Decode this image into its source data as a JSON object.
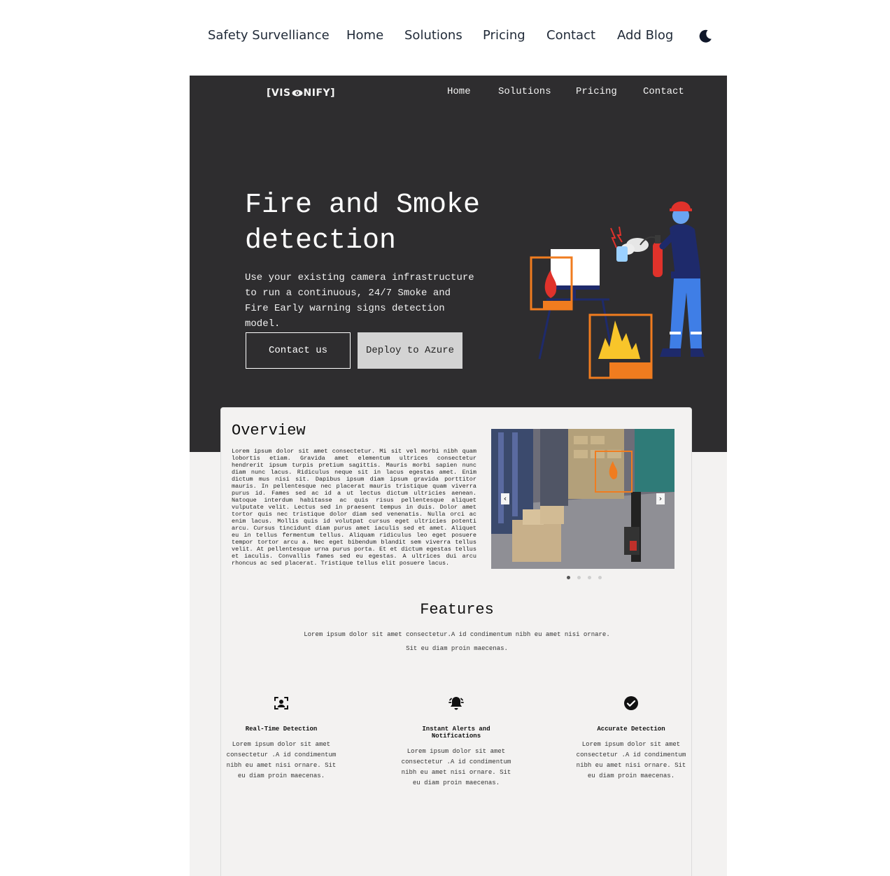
{
  "topnav": {
    "brand": "Safety Survelliance",
    "items": [
      "Home",
      "Solutions",
      "Pricing",
      "Contact",
      "Add Blog"
    ],
    "theme_toggle_icon": "moon-icon"
  },
  "preview": {
    "logo": {
      "left": "[VIS",
      "right": "NIFY]"
    },
    "nav": [
      "Home",
      "Solutions",
      "Pricing",
      "Contact"
    ],
    "hero": {
      "title": "Fire and Smoke detection",
      "description": "Use your existing camera infrastructure to run a continuous, 24/7 Smoke and Fire Early warning signs detection model.",
      "contact_label": "Contact us",
      "azure_label": "Deploy to Azure"
    },
    "overview": {
      "title": "Overview",
      "text": "Lorem ipsum dolor sit amet consectetur. Mi sit vel morbi nibh quam lobortis etiam. Gravida amet elementum ultrices consectetur hendrerit ipsum turpis pretium sagittis. Mauris morbi sapien nunc diam nunc lacus. Ridiculus neque sit in lacus egestas amet. Enim dictum mus nisi sit. Dapibus ipsum diam ipsum gravida porttitor mauris. In pellentesque nec placerat mauris tristique quam viverra purus id. Fames sed ac id a ut lectus dictum ultricies aenean. Natoque interdum habitasse ac quis risus pellentesque aliquet vulputate velit. Lectus sed in praesent tempus in duis. Dolor amet tortor quis nec tristique dolor diam sed venenatis. Nulla orci ac enim lacus. Mollis quis id volutpat cursus eget ultricies potenti arcu. Cursus tincidunt diam purus amet iaculis sed et amet. Aliquet eu in tellus fermentum tellus. Aliquam ridiculus leo eget posuere tempor tortor arcu a. Nec eget bibendum blandit sem viverra tellus velit. At pellentesque urna purus porta. Et et dictum egestas tellus et iaculis. Convallis fames sed eu egestas. A ultrices dui arcu rhoncus ac sed placerat. Tristique tellus elit posuere lacus.",
      "carousel": {
        "prev": "‹",
        "next": "›",
        "slides": 4,
        "active": 1
      }
    },
    "features": {
      "title": "Features",
      "subtitle_line1": "Lorem ipsum dolor sit amet consectetur.A id condimentum nibh eu amet nisi ornare.",
      "subtitle_line2": "Sit eu diam proin maecenas.",
      "items": [
        {
          "icon": "face-scan-icon",
          "name": "Real-Time Detection",
          "desc": "Lorem ipsum dolor sit amet consectetur .A id condimentum nibh eu amet nisi ornare. Sit eu diam proin maecenas."
        },
        {
          "icon": "alarm-bell-icon",
          "name": "Instant Alerts and Notifications",
          "desc": "Lorem ipsum dolor sit amet consectetur .A id condimentum nibh eu amet nisi ornare. Sit eu diam proin maecenas."
        },
        {
          "icon": "check-circle-icon",
          "name": "Accurate Detection",
          "desc": "Lorem ipsum dolor sit amet consectetur .A id condimentum nibh eu amet nisi ornare. Sit eu diam proin maecenas."
        }
      ]
    }
  },
  "colors": {
    "hero_background": "#2e2d2f",
    "page_background": "#f3f2f1",
    "accent_orange": "#f07c1f",
    "flame_red": "#e0322b",
    "flame_yellow": "#f8c52a",
    "worker_blue": "#3f7ee6",
    "azure_button": "#d3d3d3"
  }
}
